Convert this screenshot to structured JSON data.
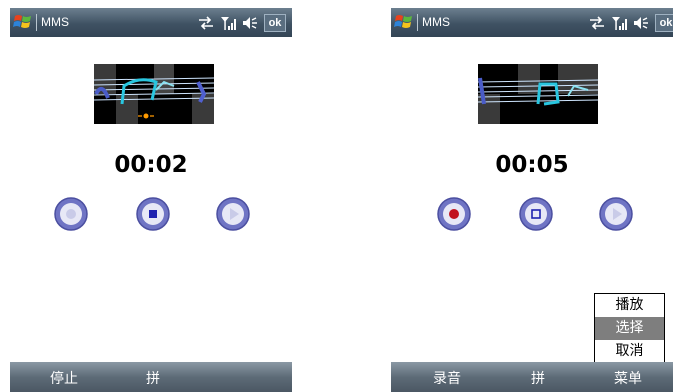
{
  "screens": [
    {
      "title": "MMS",
      "ok_label": "ok",
      "timer": "00:02",
      "soft_left": "停止",
      "soft_middle": "拼",
      "soft_right": "",
      "record_state": "inactive"
    },
    {
      "title": "MMS",
      "ok_label": "ok",
      "timer": "00:05",
      "soft_left": "录音",
      "soft_middle": "拼",
      "soft_right": "菜单",
      "record_state": "active",
      "menu": {
        "items": [
          "播放",
          "选择",
          "取消"
        ],
        "selected": "选择"
      }
    }
  ],
  "icons": [
    "windows-logo-icon",
    "sync-icon",
    "signal-icon",
    "volume-icon",
    "record-icon",
    "stop-icon",
    "play-icon"
  ],
  "colors": {
    "titlebar": "#3f5263",
    "softbar": "#5d6b77",
    "control_ring": "#6f74c4",
    "record_dot": "#c1121f"
  }
}
